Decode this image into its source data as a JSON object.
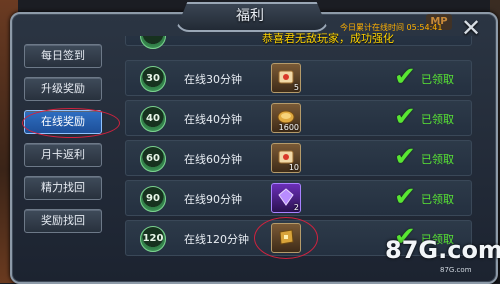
{
  "window": {
    "title": "福利",
    "close_icon": "close-x-icon",
    "mp_badge": "MP",
    "online_time": "今日累计在线时间 05:54:41",
    "marquee": "恭喜君无敌玩家，成功强化"
  },
  "sidebar": {
    "items": [
      {
        "label": "每日签到",
        "active": false
      },
      {
        "label": "升级奖励",
        "active": false
      },
      {
        "label": "在线奖励",
        "active": true
      },
      {
        "label": "月卡返利",
        "active": false
      },
      {
        "label": "精力找回",
        "active": false
      },
      {
        "label": "奖励找回",
        "active": false
      }
    ]
  },
  "rewards": {
    "rows": [
      {
        "badge": "30",
        "label": "在线30分钟",
        "item_icon": "scroll-icon",
        "item_count": "5",
        "status": "已领取"
      },
      {
        "badge": "40",
        "label": "在线40分钟",
        "item_icon": "coin-icon",
        "item_count": "1600",
        "status": "已领取"
      },
      {
        "badge": "60",
        "label": "在线60分钟",
        "item_icon": "scroll-icon",
        "item_count": "10",
        "status": "已领取"
      },
      {
        "badge": "90",
        "label": "在线90分钟",
        "item_icon": "purple-gem-icon",
        "item_count": "2",
        "status": "已领取"
      },
      {
        "badge": "120",
        "label": "在线120分钟",
        "item_icon": "gold-chest-icon",
        "item_count": "",
        "status": "已领取"
      }
    ]
  },
  "watermark": {
    "text": "87G.com",
    "sub": "87G.com"
  },
  "colors": {
    "accent_blue": "#2f6fc3",
    "claimed_green": "#58e633",
    "highlight_red": "#d0223e",
    "marquee_yellow": "#ffd400"
  }
}
